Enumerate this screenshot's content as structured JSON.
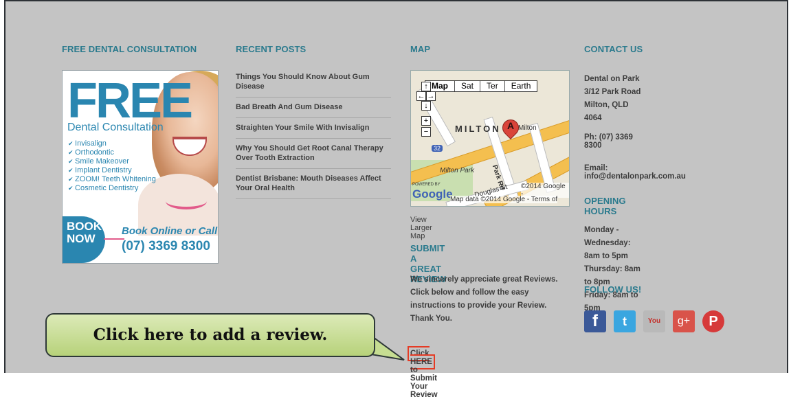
{
  "columns": {
    "consultation": {
      "title": "FREE DENTAL CONSULTATION",
      "ad": {
        "headline": "FREE",
        "subhead": "Dental Consultation",
        "services": [
          "Invisalign",
          "Orthodontic",
          "Smile Makeover",
          "Implant Dentistry",
          "ZOOM! Teeth Whitening",
          "Cosmetic Dentistry"
        ],
        "book_label_1": "BOOK",
        "book_label_2": "NOW",
        "cta": "Book Online or Call",
        "phone": "(07) 3369 8300"
      }
    },
    "recent_posts": {
      "title": "RECENT POSTS",
      "items": [
        "Things You Should Know About Gum Disease",
        "Bad Breath And Gum Disease",
        "Straighten Your Smile With Invisalign",
        "Why You Should Get Root Canal Therapy Over Tooth Extraction",
        "Dentist Brisbane: Mouth Diseases Affect Your Oral Health"
      ]
    },
    "map": {
      "title": "MAP",
      "map_types": [
        "Map",
        "Sat",
        "Ter",
        "Earth"
      ],
      "marker_label": "A",
      "labels": {
        "milton_caps": "MILTON",
        "milton": "Milton",
        "milton_park": "Milton Park",
        "park_rd": "Park Rd",
        "douglas_st": "Douglas St",
        "route": "32",
        "powered_by": "POWERED BY",
        "google": "Google",
        "copyright": "©2014 Google -",
        "map_data": "Map data ©2014 Google - Terms of"
      },
      "view_larger": "View Larger Map",
      "review_title": "SUBMIT A GREAT REVIEW",
      "review_text": "We sincerely appreciate great Reviews. Click below and follow the easy instructions to provide your Review. Thank You.",
      "click_here": "Click HERE",
      "click_suffix": " to Submit Your Review"
    },
    "contact": {
      "title": "CONTACT US",
      "address": [
        "Dental on Park",
        "3/12 Park Road",
        "Milton, QLD 4064"
      ],
      "phone": "Ph: (07) 3369 8300",
      "email": "Email: info@dentalonpark.com.au",
      "hours_title": "OPENING HOURS",
      "hours": [
        "Monday - Wednesday: 8am to 5pm",
        "Thursday: 8am to 8pm",
        "Friday: 8am to 5pm"
      ],
      "follow_title": "FOLLOW US!",
      "social": [
        {
          "name": "facebook",
          "glyph": "f",
          "color": "#3b5998"
        },
        {
          "name": "twitter",
          "glyph": "t",
          "color": "#3aa6e0"
        },
        {
          "name": "youtube",
          "glyph": "You",
          "color": "#b9b9b9"
        },
        {
          "name": "google-plus",
          "glyph": "g+",
          "color": "#d9534a"
        },
        {
          "name": "pinterest",
          "glyph": "P",
          "color": "#d63a3a"
        }
      ]
    }
  },
  "callout": {
    "text": "Click here to add a review."
  }
}
